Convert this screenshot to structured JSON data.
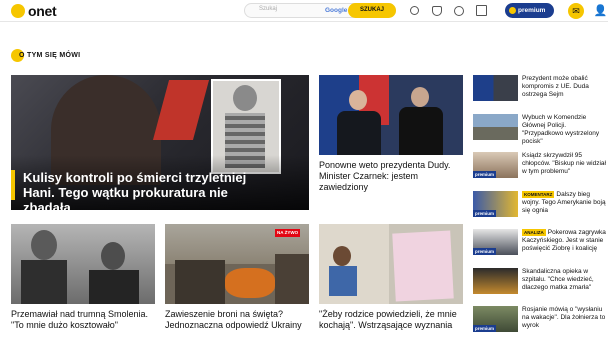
{
  "header": {
    "logo": "onet",
    "search_placeholder": "Szukaj",
    "search_provider": "Google",
    "search_button": "SZUKAJ",
    "premium": "premium"
  },
  "section": {
    "title": "O TYM SIĘ MÓWI"
  },
  "hero": {
    "title": "Kulisy kontroli po śmierci trzyletniej Hani. Tego wątku prokuratura nie zbadała"
  },
  "top_middle": {
    "title": "Ponowne weto prezydenta Dudy. Minister Czarnek: jestem zawiedziony"
  },
  "bottom": [
    {
      "title": "Przemawiał nad trumną Smolenia. \"To mnie dużo kosztowało\""
    },
    {
      "title": "Zawieszenie broni na święta? Jednoznaczna odpowiedź Ukrainy",
      "badge": "NA ŻYWO"
    },
    {
      "title": "\"Żeby rodzice powiedzieli, że mnie kochają\". Wstrząsające wyznania"
    }
  ],
  "side": [
    {
      "text": "Prezydent może obalić kompromis z UE. Duda ostrzega Sejm"
    },
    {
      "text": "Wybuch w Komendzie Głównej Policji. \"Przypadkowo wystrzelony pocisk\""
    },
    {
      "text": "Ksiądz skrzywdził 95 chłopców. \"Biskup nie widział w tym problemu\"",
      "premium": "premium"
    },
    {
      "text": "Dalszy bieg wojny. Tego Amerykanie boją się ognia",
      "tag": "KOMENTARZ",
      "premium": "premium"
    },
    {
      "text": "Pokerowa zagrywka Kaczyńskiego. Jest w stanie poświęcić Ziobrę i koalicję",
      "tag": "ANALIZA",
      "premium": "premium"
    },
    {
      "text": "Skandaliczna opieka w szpitalu. \"Chce wiedzieć, dlaczego matka zmarła\""
    },
    {
      "text": "Rosjanie mówią o \"wysłaniu na wakacje\". Dla żołnierza to wyrok",
      "premium": "premium"
    }
  ],
  "colors": {
    "brand_yellow": "#f6c600",
    "premium_blue": "#1b3d8f"
  }
}
